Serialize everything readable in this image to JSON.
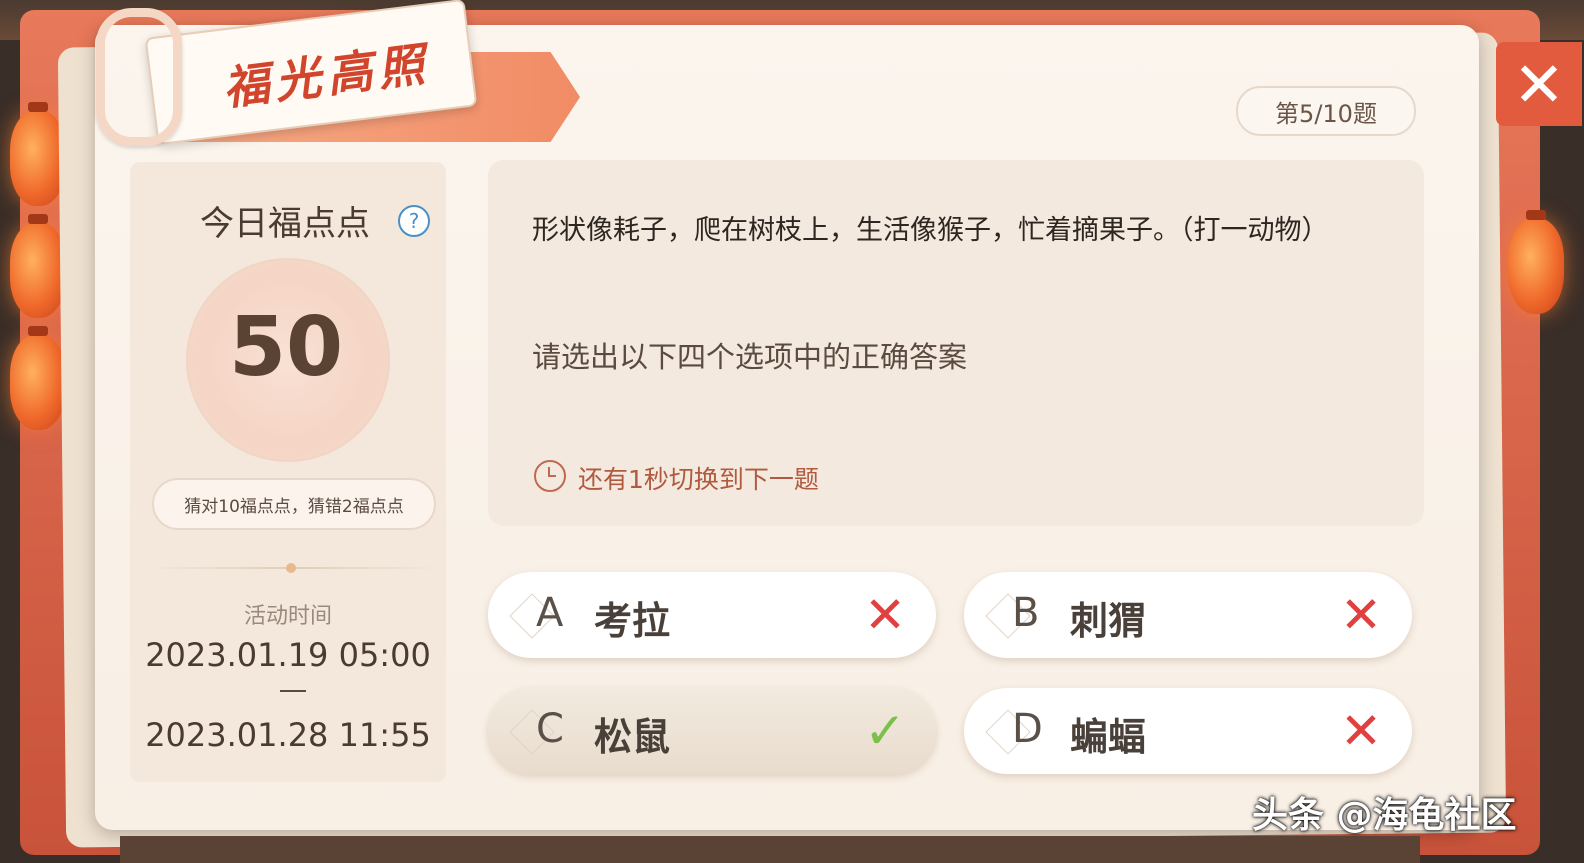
{
  "title": "福光高照",
  "progress": "第5/10题",
  "left": {
    "title": "今日福点点",
    "help_icon": "?",
    "points": "50",
    "rule": "猜对10福点点，猜错2福点点",
    "activity_label": "活动时间",
    "start": "2023.01.19 05:00",
    "end": "2023.01.28 11:55"
  },
  "question": {
    "text": "形状像耗子，爬在树枝上，生活像猴子，忙着摘果子。（打一动物）",
    "instruction": "请选出以下四个选项中的正确答案",
    "countdown": "还有1秒切换到下一题"
  },
  "options": [
    {
      "letter": "A",
      "text": "考拉",
      "mark": "✕",
      "result": "wrong"
    },
    {
      "letter": "B",
      "text": "刺猬",
      "mark": "✕",
      "result": "wrong"
    },
    {
      "letter": "C",
      "text": "松鼠",
      "mark": "✓",
      "result": "correct"
    },
    {
      "letter": "D",
      "text": "蝙蝠",
      "mark": "✕",
      "result": "wrong"
    }
  ],
  "close_icon": "✕",
  "watermark": "头条 @海龟社区",
  "colors": {
    "accent": "#d0452c",
    "correct": "#7ac04a",
    "wrong": "#e04040"
  }
}
